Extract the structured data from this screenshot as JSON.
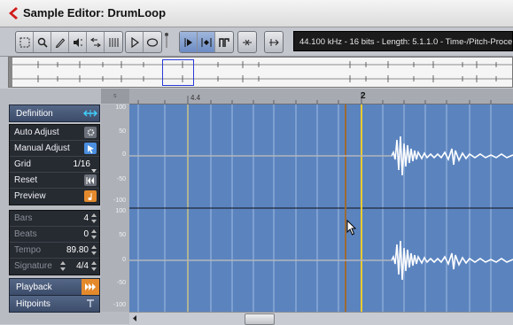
{
  "window": {
    "title": "Sample Editor: DrumLoop"
  },
  "toolbar": {
    "info_text": "44.100 kHz - 16 bits - Length: 5.1.1.0 - Time-/Pitch-Proce",
    "tools": [
      "range-select-icon",
      "zoom-icon",
      "pencil-icon",
      "audition-icon",
      "scrub-icon",
      "grid-icon"
    ],
    "transport": [
      "play-icon",
      "loop-icon"
    ],
    "hitpoint_tools": [
      "hitpoint-edit-icon",
      "hitpoint-create-icon",
      "show-regions-icon"
    ],
    "extra": [
      "snap-icon",
      "autoscroll-icon"
    ]
  },
  "ruler": {
    "mark_1": "4.4",
    "mark_2": "2"
  },
  "panel": {
    "definition": "Definition",
    "auto_adjust": "Auto Adjust",
    "manual_adjust": "Manual Adjust",
    "grid_label": "Grid",
    "grid_value": "1/16",
    "reset": "Reset",
    "preview": "Preview",
    "bars_label": "Bars",
    "bars_value": "4",
    "beats_label": "Beats",
    "beats_value": "0",
    "tempo_label": "Tempo",
    "tempo_value": "89.80",
    "signature_label": "Signature",
    "signature_value": "4/4",
    "playback": "Playback",
    "hitpoints": "Hitpoints"
  },
  "scale": {
    "top": [
      "100",
      "50",
      "0",
      "-50",
      "-100"
    ],
    "bottom": [
      "100",
      "50",
      "0",
      "-50",
      "-100"
    ]
  },
  "colors": {
    "wave_bg": "#5b84bf",
    "cursor": "#e8c84a",
    "panel_header": "#3c4c6a"
  }
}
